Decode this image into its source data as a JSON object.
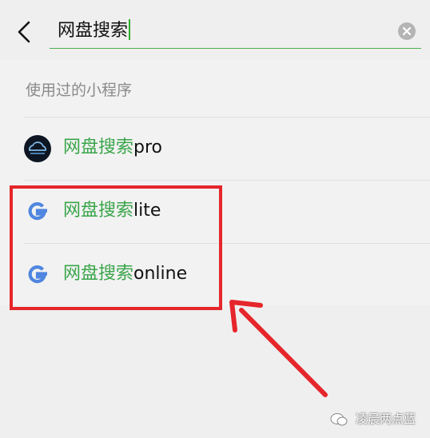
{
  "header": {
    "back_icon": "chevron-left-icon",
    "search_value": "网盘搜索",
    "clear_icon": "clear-circle-icon"
  },
  "section": {
    "title": "使用过的小程序"
  },
  "results": [
    {
      "highlight": "网盘搜索",
      "suffix": "pro",
      "icon": "cloud-logo-icon"
    },
    {
      "highlight": "网盘搜索",
      "suffix": "lite",
      "icon": "google-g-icon"
    },
    {
      "highlight": "网盘搜索",
      "suffix": "online",
      "icon": "google-g-icon"
    }
  ],
  "watermark": {
    "text": "凌晨两点蓝"
  },
  "colors": {
    "highlight": "#3aa54a",
    "annotation": "#e5262b",
    "search_underline": "#4bb04b"
  }
}
